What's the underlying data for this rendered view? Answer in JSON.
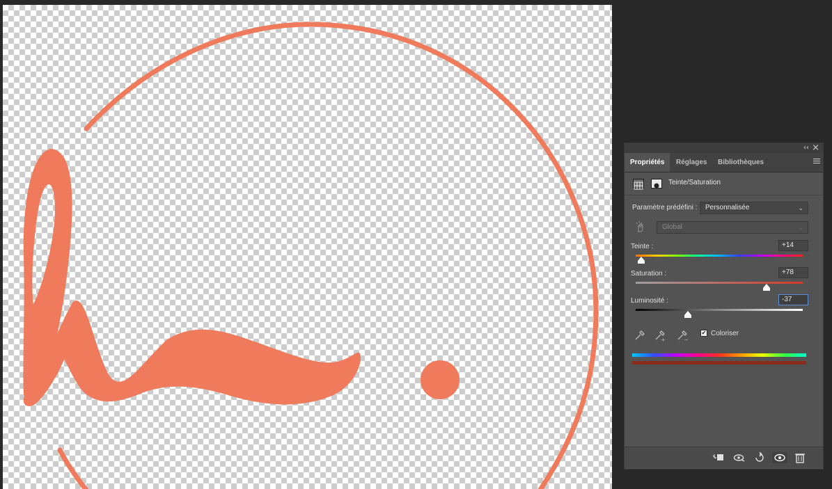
{
  "panel": {
    "tabs": [
      {
        "label": "Propriétés",
        "active": true
      },
      {
        "label": "Réglages",
        "active": false
      },
      {
        "label": "Bibliothèques",
        "active": false
      }
    ],
    "collapse_glyph": "‹‹",
    "close_glyph": "×",
    "adjustment_title": "Teinte/Saturation",
    "preset": {
      "label": "Paramètre prédéfini :",
      "value": "Personnalisée"
    },
    "channel": {
      "value": "Global",
      "disabled": true
    },
    "hue": {
      "label": "Teinte :",
      "value": "+14",
      "position_fraction": 0.04
    },
    "saturation": {
      "label": "Saturation :",
      "value": "+78",
      "position_fraction": 0.78
    },
    "lightness": {
      "label": "Luminosité :",
      "value": "-37",
      "position_fraction": 0.32
    },
    "colorize": {
      "label": "Coloriser",
      "checked": true,
      "check_glyph": "✔"
    },
    "colors": {
      "accent": "#5b8ed7",
      "artwork": "#ef7c5b",
      "result_bar": "#8a2c1c"
    },
    "footer_icons": [
      "clip-to-layer-icon",
      "view-previous-state-icon",
      "reset-icon",
      "visibility-eye-icon",
      "trash-icon"
    ]
  }
}
